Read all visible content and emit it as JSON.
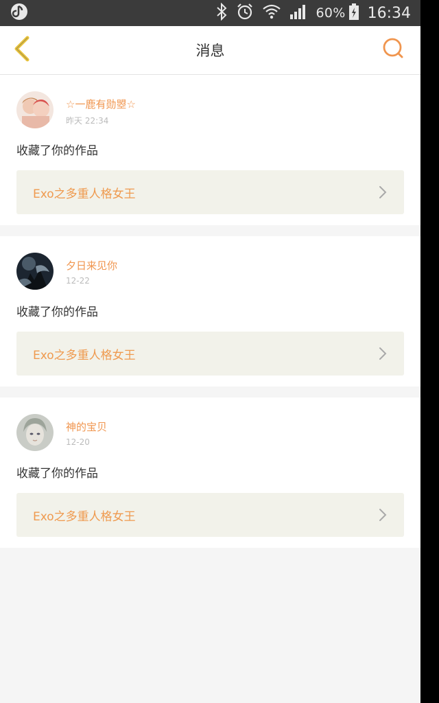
{
  "status_bar": {
    "battery": "60%",
    "time": "16:34",
    "icons": [
      "app-notification-icon",
      "bluetooth-icon",
      "alarm-icon",
      "wifi-icon",
      "signal-icon",
      "battery-charging-icon"
    ]
  },
  "header": {
    "title": "消息",
    "back_icon": "chevron-left-icon",
    "search_icon": "search-icon"
  },
  "colors": {
    "accent": "#f0954e",
    "nav_back": "#e9c43d",
    "link_bg": "#f2f2ea",
    "status_bar": "#3b3b3b"
  },
  "notifications": [
    {
      "user": "☆一鹿有勋曌☆",
      "time": "昨天 22:34",
      "action": "收藏了你的作品",
      "work": "Exo之多重人格女王",
      "avatar": "avatar-photo-couple"
    },
    {
      "user": "夕日来见你",
      "time": "12-22",
      "action": "收藏了你的作品",
      "work": "Exo之多重人格女王",
      "avatar": "avatar-photo-dark"
    },
    {
      "user": "神的宝贝",
      "time": "12-20",
      "action": "收藏了你的作品",
      "work": "Exo之多重人格女王",
      "avatar": "avatar-photo-doll"
    }
  ]
}
